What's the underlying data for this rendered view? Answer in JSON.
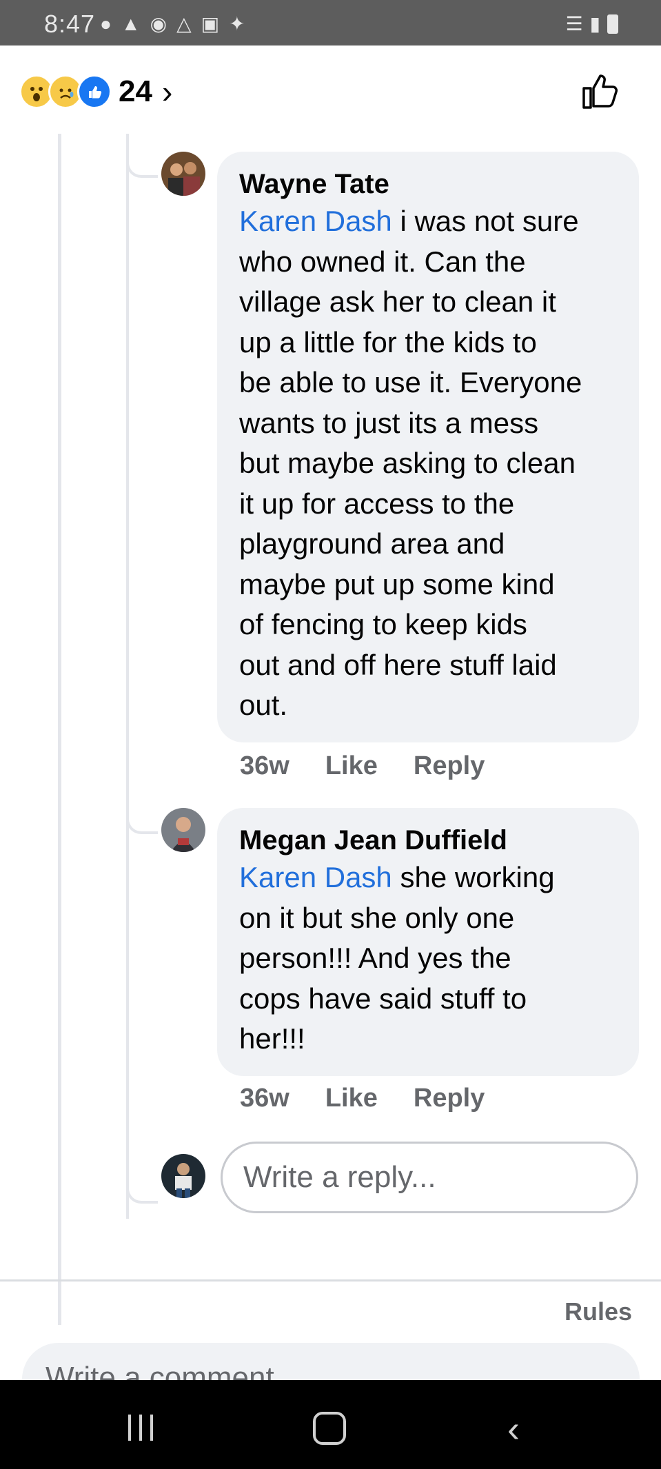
{
  "status_bar": {
    "time": "8:47"
  },
  "header": {
    "reaction_icons": [
      "wow-icon",
      "sad-icon",
      "like-icon"
    ],
    "reaction_count": "24"
  },
  "comments": [
    {
      "author": "Wayne Tate",
      "mention": "Karen Dash",
      "lines": [
        " i was not sure",
        "who owned it. Can the",
        "village ask her to clean it",
        "up a little for the kids to",
        "be able to use it. Everyone",
        "wants to just its a mess",
        "but maybe asking to clean",
        "it up for access to the",
        "playground area and",
        "maybe put up some kind",
        "of fencing to keep kids",
        "out and off here stuff laid",
        "out."
      ],
      "time": "36w",
      "like_label": "Like",
      "reply_label": "Reply"
    },
    {
      "author": "Megan Jean Duffield",
      "mention": "Karen Dash",
      "lines": [
        " she working",
        "on it but she only one",
        "person!!! And yes the",
        "cops have said stuff to",
        "her!!!"
      ],
      "time": "36w",
      "like_label": "Like",
      "reply_label": "Reply"
    }
  ],
  "reply_box": {
    "placeholder": "Write a reply..."
  },
  "footer": {
    "rules_label": "Rules",
    "comment_placeholder": "Write a comment..."
  },
  "colors": {
    "mention": "#216fdb",
    "bubble": "#f0f2f5",
    "meta_text": "#65676b",
    "like_blue": "#1877f2"
  }
}
